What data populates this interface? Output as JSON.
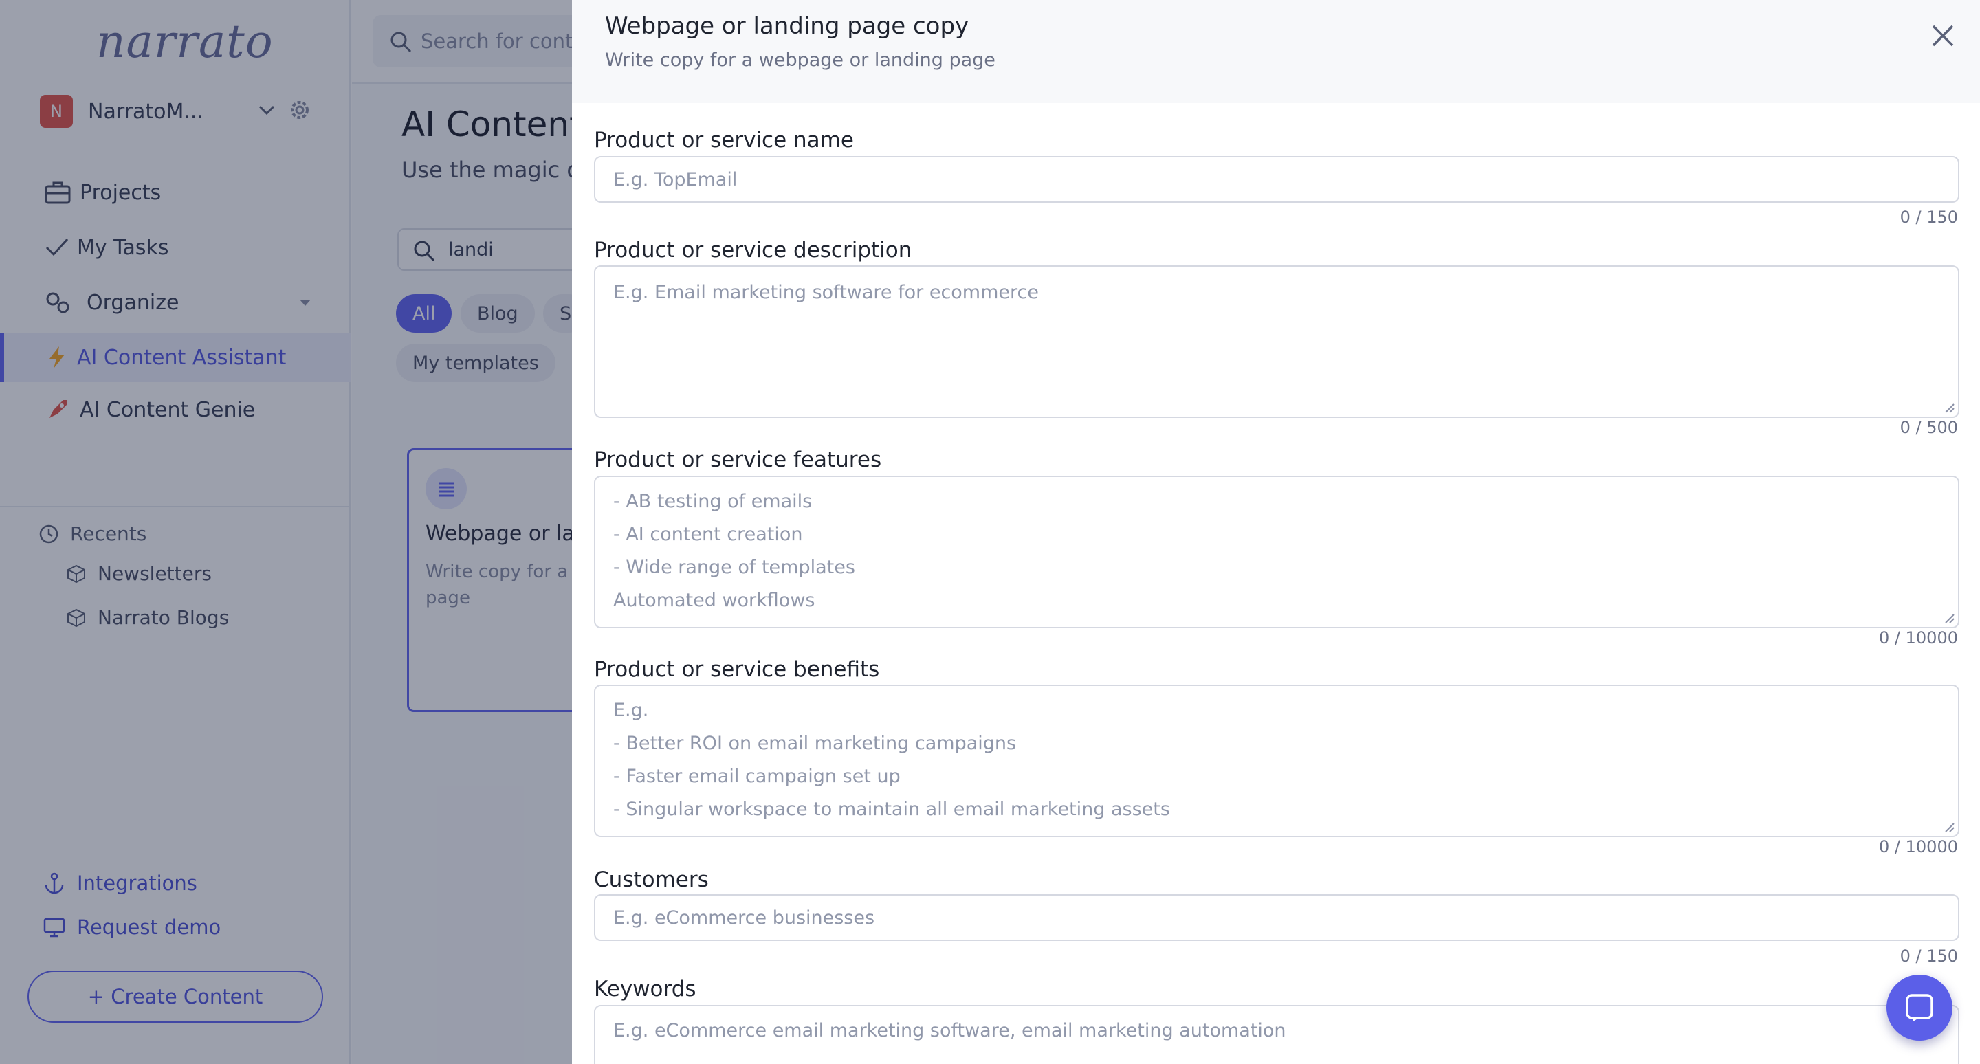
{
  "app": {
    "logo": "narrato",
    "workspace": {
      "initial": "N",
      "name": "NarratoM..."
    },
    "nav": [
      {
        "label": "Projects"
      },
      {
        "label": "My Tasks"
      },
      {
        "label": "Organize"
      },
      {
        "label": "AI Content Assistant"
      },
      {
        "label": "AI Content Genie"
      }
    ],
    "recents": {
      "heading": "Recents",
      "items": [
        "Newsletters",
        "Narrato Blogs"
      ]
    },
    "bottom_links": [
      "Integrations",
      "Request demo"
    ],
    "create_button": "+ Create Content",
    "top_search": {
      "placeholder": "Search for conte"
    },
    "page_title": "AI Content",
    "page_subtitle": "Use the magic of",
    "template_search": {
      "value": "landi"
    },
    "chips": [
      "All",
      "Blog",
      "S",
      "My templates"
    ],
    "card": {
      "title": "Webpage or landi",
      "description_line1": "Write copy for a w",
      "description_line2": "page"
    }
  },
  "drawer": {
    "title": "Webpage or landing page copy",
    "subtitle": "Write copy for a webpage or landing page",
    "fields": {
      "name": {
        "label": "Product or service name",
        "placeholder": "E.g. TopEmail",
        "counter": "0 / 150"
      },
      "description": {
        "label": "Product or service description",
        "placeholder": "E.g. Email marketing software for ecommerce",
        "counter": "0 / 500"
      },
      "features": {
        "label": "Product or service features",
        "lines": [
          "- AB testing of emails",
          "- AI content creation",
          "- Wide range of templates",
          "Automated workflows"
        ],
        "counter": "0 / 10000"
      },
      "benefits": {
        "label": "Product or service benefits",
        "lines": [
          "E.g.",
          "- Better ROI on email marketing campaigns",
          "- Faster email campaign set up",
          "- Singular workspace to maintain all email marketing assets"
        ],
        "counter": "0 / 10000"
      },
      "customers": {
        "label": "Customers",
        "placeholder": "E.g. eCommerce businesses",
        "counter": "0 / 150"
      },
      "keywords": {
        "label": "Keywords",
        "placeholder": "E.g. eCommerce email marketing software, email marketing automation"
      }
    }
  },
  "colors": {
    "accent": "#6366f1",
    "overlay": "rgba(20,28,58,0.42)",
    "chat": "#5b5fe8"
  }
}
